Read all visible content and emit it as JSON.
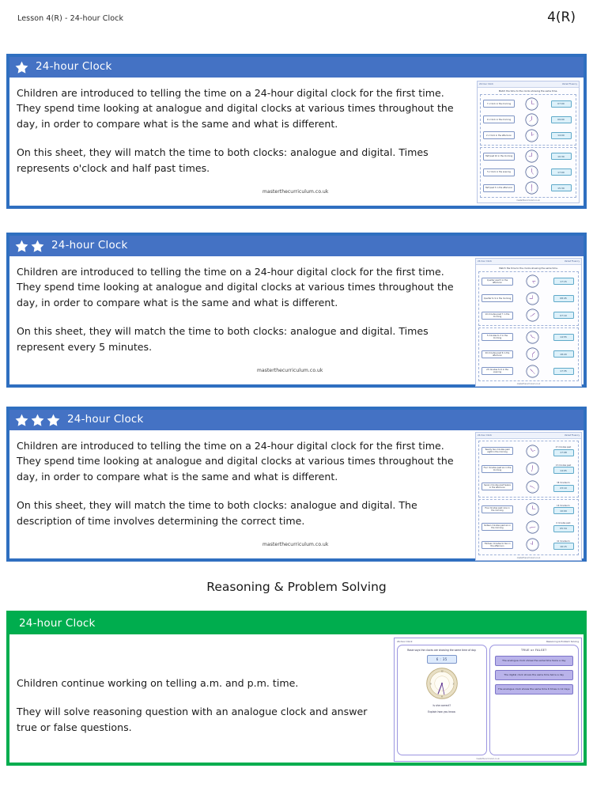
{
  "header": {
    "lesson_label": "Lesson 4(R)  - 24-hour Clock",
    "page_code": "4(R)"
  },
  "section_title": "Reasoning & Problem Solving",
  "watermark": "masterthecurriculum.co.uk",
  "colors": {
    "blue": "#4472C4",
    "blue_border": "#2F6FC0",
    "green": "#00AD4E",
    "purple_box": "#B9B3EA",
    "digital_blue": "#DDF1FA"
  },
  "varied_fluency": [
    {
      "stars": 1,
      "title": "24-hour Clock",
      "paragraph_1": "Children are introduced to telling the time on a 24-hour digital clock for the first time. They spend time looking at analogue and digital clocks at various times throughout the day, in order to compare what is the same and what is different.",
      "paragraph_2": "On this sheet, they will match the time to both clocks: analogue and digital. Times represents o'clock and half past times.",
      "worksheet": {
        "top_left": "24-hour Clock",
        "top_right": "Varied Fluency",
        "page_number": "1",
        "instruction": "Match the time to the clocks showing the same time.",
        "rows": [
          {
            "description": "7 o'clock in the morning",
            "digital": "07:00",
            "label": ""
          },
          {
            "description": "9 o'clock in the morning",
            "digital": "09:00",
            "label": ""
          },
          {
            "description": "2 o'clock in the afternoon",
            "digital": "14:00",
            "label": ""
          },
          {
            "description": "Half past 10 in the morning",
            "digital": "10:30",
            "label": ""
          },
          {
            "description": "5 o'clock in the evening",
            "digital": "17:00",
            "label": ""
          },
          {
            "description": "Half past 3 in the afternoon",
            "digital": "15:30",
            "label": ""
          }
        ],
        "footer": "masterthecurriculum.co.uk"
      }
    },
    {
      "stars": 2,
      "title": "24-hour Clock",
      "paragraph_1": "Children are introduced to telling the time on a 24-hour digital clock for the first time. They spend time looking at analogue and digital clocks at various times throughout the day, in order to compare what is the same and what is different.",
      "paragraph_2": "On this sheet, they will match the time to both clocks: analogue and digital. Times represent every 5 minutes.",
      "worksheet": {
        "top_left": "24-hour Clock",
        "top_right": "Varied Fluency",
        "page_number": "2",
        "instruction": "Match the time to the clocks showing the same time.",
        "rows": [
          {
            "description": "Quarter past 5 in the afternoon",
            "digital": "17:15",
            "label": ""
          },
          {
            "description": "Quarter to 9 in the morning",
            "digital": "08:45",
            "label": ""
          },
          {
            "description": "10 minutes past 7 in the morning",
            "digital": "07:10",
            "label": ""
          },
          {
            "description": "5 minutes to 3 in the morning",
            "digital": "14:55",
            "label": ""
          },
          {
            "description": "20 minutes past 6 in the afternoon",
            "digital": "18:20",
            "label": ""
          },
          {
            "description": "25 minutes to 6 in the evening",
            "digital": "17:35",
            "label": ""
          }
        ],
        "footer": "masterthecurriculum.co.uk"
      }
    },
    {
      "stars": 3,
      "title": "24-hour Clock",
      "paragraph_1": "Children are introduced to telling the time on a 24-hour digital clock for the first time. They spend time looking at analogue and digital clocks at various times throughout the day, in order to compare what is the same and what is different.",
      "paragraph_2": "On this sheet, they will match the time to both clocks: analogue and digital. The description of time involves determining the correct time.",
      "worksheet": {
        "top_left": "24-hour Clock",
        "top_right": "Varied Fluency",
        "page_number": "3",
        "instruction": "Match the time to the clocks showing the same time.",
        "rows": [
          {
            "description": "Twenty two minutes past eight in the morning",
            "label": "47 minutes past",
            "digital": "17:08"
          },
          {
            "description": "Four minutes past six in the morning",
            "label": "13 minutes past",
            "digital": "14:05"
          },
          {
            "description": "Seven minutes past twelve in the afternoon",
            "label": "38 minutes to",
            "digital": "23:10"
          },
          {
            "description": "Five minutes past nine in the morning",
            "label": "16 minutes to",
            "digital": "10:09"
          },
          {
            "description": "Sixteen minutes past six in the morning",
            "label": "6 minutes past",
            "digital": "05:34"
          },
          {
            "description": "Thirteen minutes to two in the afternoon",
            "label": "41 minutes to",
            "digital": "16:15"
          }
        ],
        "footer": "masterthecurriculum.co.uk"
      }
    }
  ],
  "reasoning": {
    "title": "24-hour Clock",
    "paragraph_1": "Children continue working on telling a.m. and p.m. time.",
    "paragraph_2": "They will solve reasoning question with an analogue clock and answer true or false questions.",
    "worksheet": {
      "top_left": "24-hour Clock",
      "top_right": "Reasoning & Problem Solving",
      "page_number": "1",
      "left_panel": {
        "question": "Rosie says the clocks are showing the same time of day.",
        "digital_time": "6 : 35",
        "prompt_1": "Is she correct?",
        "prompt_2": "Explain how you know."
      },
      "right_panel": {
        "title": "TRUE  or FALSE?",
        "statements": [
          "The analogue clock shows the same time twice a day",
          "The digital clock shows the same time twice a day",
          "The analogue clock shows the same time 6 times in 12 days"
        ]
      },
      "footer": "masterthecurriculum.co.uk"
    }
  }
}
